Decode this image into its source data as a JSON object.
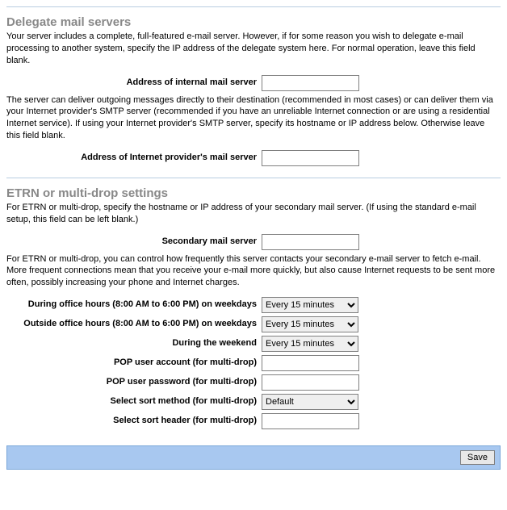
{
  "section1": {
    "title": "Delegate mail servers",
    "desc1": "Your server includes a complete, full-featured e-mail server. However, if for some reason you wish to delegate e-mail processing to another system, specify the IP address of the delegate system here. For normal operation, leave this field blank.",
    "label_internal": "Address of internal mail server",
    "value_internal": "",
    "desc2": "The server can deliver outgoing messages directly to their destination (recommended in most cases) or can deliver them via your Internet provider's SMTP server (recommended if you have an unreliable Internet connection or are using a residential Internet service). If using your Internet provider's SMTP server, specify its hostname or IP address below. Otherwise leave this field blank.",
    "label_isp": "Address of Internet provider's mail server",
    "value_isp": ""
  },
  "section2": {
    "title": "ETRN or multi-drop settings",
    "desc1": "For ETRN or multi-drop, specify the hostname or IP address of your secondary mail server. (If using the standard e-mail setup, this field can be left blank.)",
    "label_secondary": "Secondary mail server",
    "value_secondary": "",
    "desc2": "For ETRN or multi-drop, you can control how frequently this server contacts your secondary e-mail server to fetch e-mail. More frequent connections mean that you receive your e-mail more quickly, but also cause Internet requests to be sent more often, possibly increasing your phone and Internet charges.",
    "label_office": "During office hours (8:00 AM to 6:00 PM) on weekdays",
    "value_office": "Every 15 minutes",
    "label_outside": "Outside office hours (8:00 AM to 6:00 PM) on weekdays",
    "value_outside": "Every 15 minutes",
    "label_weekend": "During the weekend",
    "value_weekend": "Every 15 minutes",
    "label_popuser": "POP user account (for multi-drop)",
    "value_popuser": "",
    "label_poppass": "POP user password (for multi-drop)",
    "value_poppass": "",
    "label_sortmethod": "Select sort method (for multi-drop)",
    "value_sortmethod": "Default",
    "label_sortheader": "Select sort header (for multi-drop)",
    "value_sortheader": ""
  },
  "footer": {
    "save_label": "Save"
  }
}
